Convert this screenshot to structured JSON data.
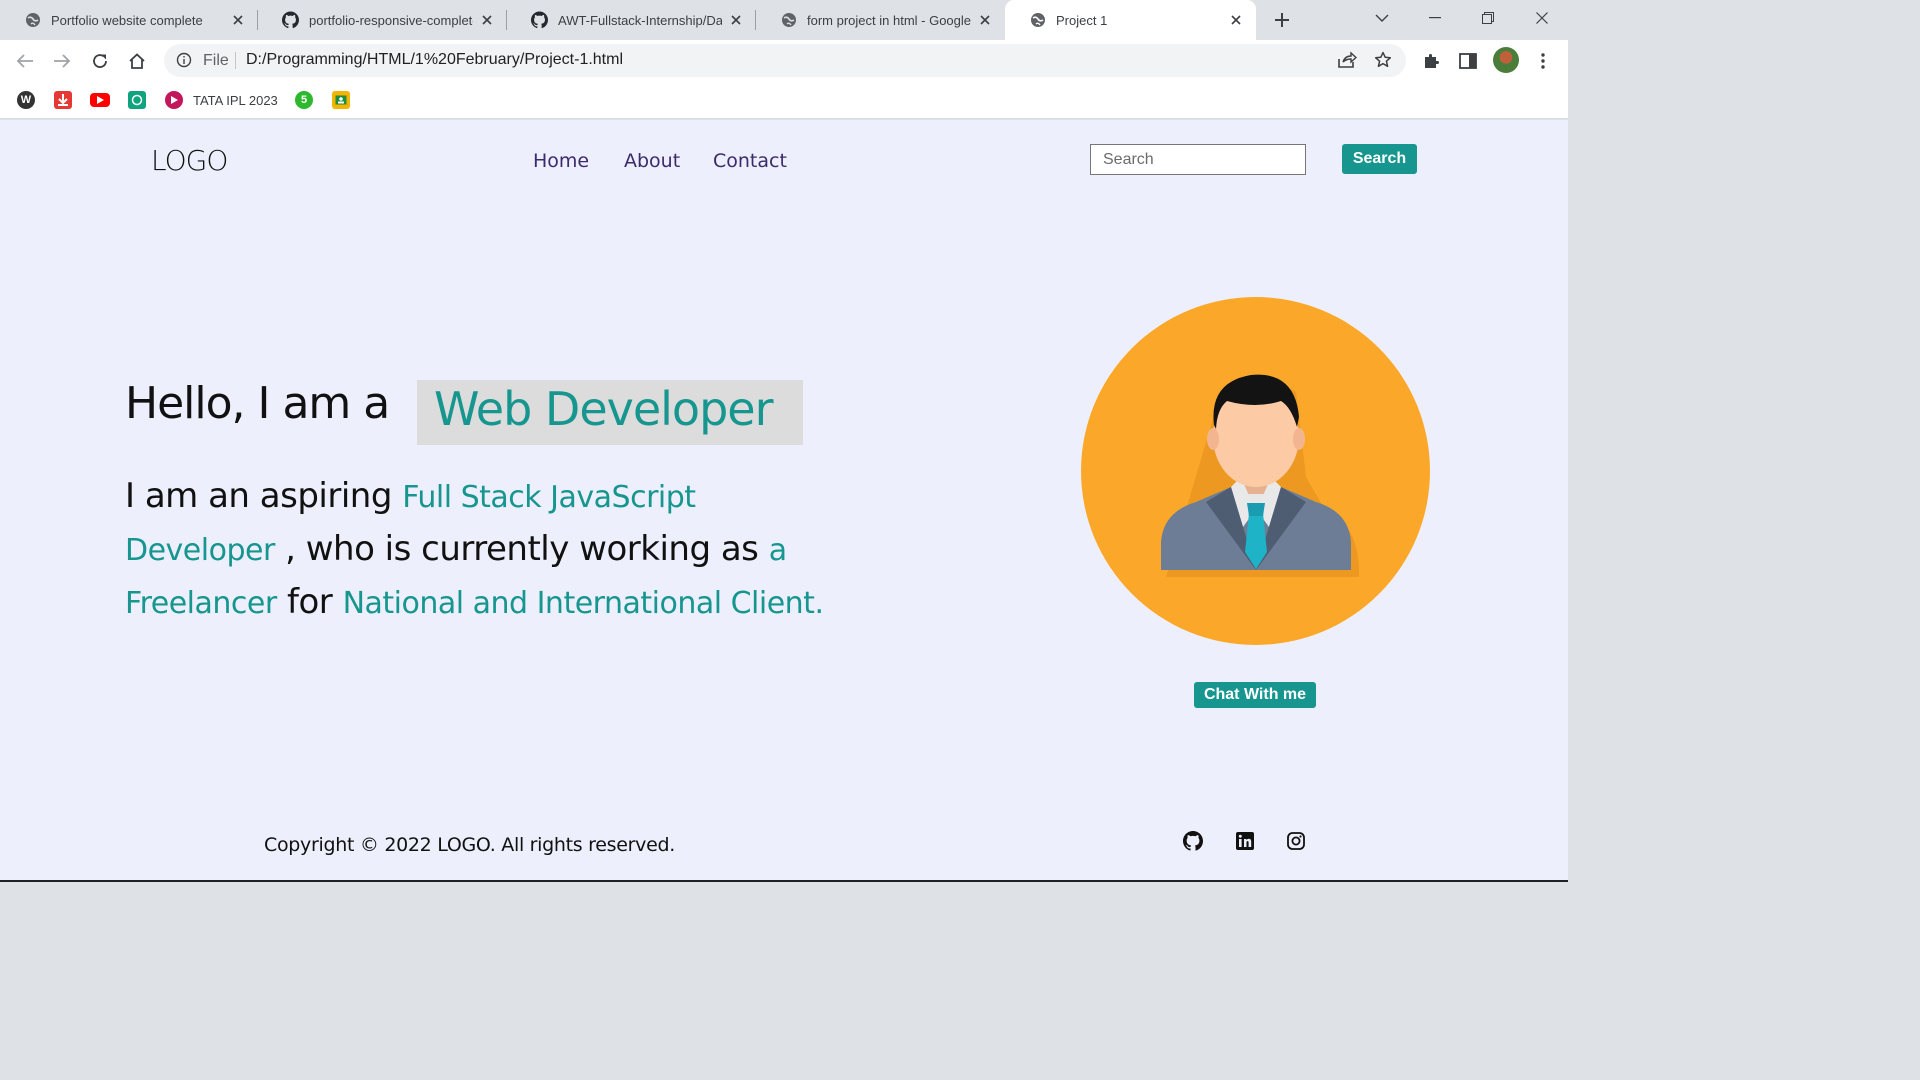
{
  "browser": {
    "tabs": [
      {
        "title": "Portfolio website complete",
        "favicon": "globe-icon",
        "active": false
      },
      {
        "title": "portfolio-responsive-complete",
        "favicon": "github-icon",
        "active": false
      },
      {
        "title": "AWT-Fullstack-Internship/Day",
        "favicon": "github-icon",
        "active": false
      },
      {
        "title": "form project in html - Google S",
        "favicon": "globe-icon",
        "active": false
      },
      {
        "title": "Project 1",
        "favicon": "globe-icon",
        "active": true
      }
    ],
    "address": {
      "scheme_label": "File",
      "url": "D:/Programming/HTML/1%20February/Project-1.html"
    },
    "bookmarks": [
      {
        "label": "",
        "icon": "wordpress-icon",
        "color": "#333333"
      },
      {
        "label": "",
        "icon": "download-icon",
        "color": "#e53935"
      },
      {
        "label": "",
        "icon": "youtube-icon",
        "color": "#ff0000"
      },
      {
        "label": "",
        "icon": "chatgpt-icon",
        "color": "#10a37f"
      },
      {
        "label": "TATA IPL 2023",
        "icon": "jiocinema-icon",
        "color": "#c2185b"
      },
      {
        "label": "",
        "icon": "five-icon",
        "color": "#2eb82e"
      },
      {
        "label": "",
        "icon": "classroom-icon",
        "color": "#f4b400"
      }
    ]
  },
  "site": {
    "logo": "LOGO",
    "nav": [
      "Home",
      "About",
      "Contact"
    ],
    "search_placeholder": "Search",
    "search_button": "Search",
    "hero": {
      "greeting": "Hello, I am a",
      "role": "Web Developer",
      "line1_plain": "I am an aspiring ",
      "line1_hl": "Full Stack JavaScript",
      "line2_hl": "Developer",
      "line2_plain": " , who is currently working as ",
      "line2_hl2": "a",
      "line3_hl": "Freelancer",
      "line3_plain": " for ",
      "line3_hl2": "National and International Client."
    },
    "chat_button": "Chat With me",
    "copyright": "Copyright © 2022 LOGO. All rights reserved.",
    "social_icons": [
      "github-icon",
      "linkedin-icon",
      "instagram-icon"
    ],
    "colors": {
      "accent": "#16968f",
      "avatar_bg": "#fba82a",
      "page_bg": "#edf0fc",
      "nav_text": "#3d2a6b"
    }
  }
}
